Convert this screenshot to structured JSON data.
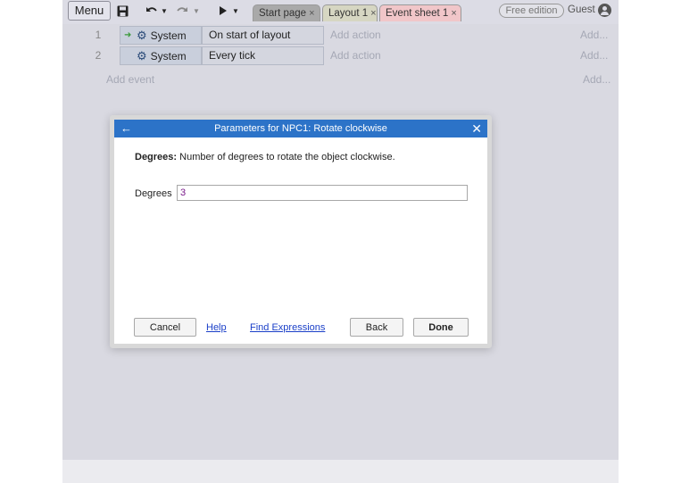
{
  "toolbar": {
    "menu_label": "Menu",
    "icons": [
      "save-icon",
      "undo-icon",
      "redo-icon",
      "play-icon"
    ],
    "tabs": [
      {
        "label": "Start page",
        "close": "×"
      },
      {
        "label": "Layout 1",
        "close": "×"
      },
      {
        "label": "Event sheet 1",
        "close": "×"
      }
    ],
    "edition_badge": "Free edition",
    "user_label": "Guest"
  },
  "events": [
    {
      "number": "1",
      "object": "System",
      "condition": "On start of layout",
      "add_action": "Add action",
      "add_more": "Add..."
    },
    {
      "number": "2",
      "object": "System",
      "condition": "Every tick",
      "add_action": "Add action",
      "add_more": "Add..."
    }
  ],
  "add_event_label": "Add event",
  "add_event_more": "Add...",
  "dialog": {
    "title": "Parameters for NPC1: Rotate clockwise",
    "param_name": "Degrees:",
    "param_description": "Number of degrees to rotate the object clockwise.",
    "field_label": "Degrees",
    "field_value": "3",
    "cancel_label": "Cancel",
    "help_label": "Help",
    "find_expressions_label": "Find Expressions",
    "back_label": "Back",
    "done_label": "Done"
  },
  "colors": {
    "title_bar": "#2c73c8",
    "tab_event_sheet": "#f1c6c9",
    "link": "#1a3fc8"
  }
}
